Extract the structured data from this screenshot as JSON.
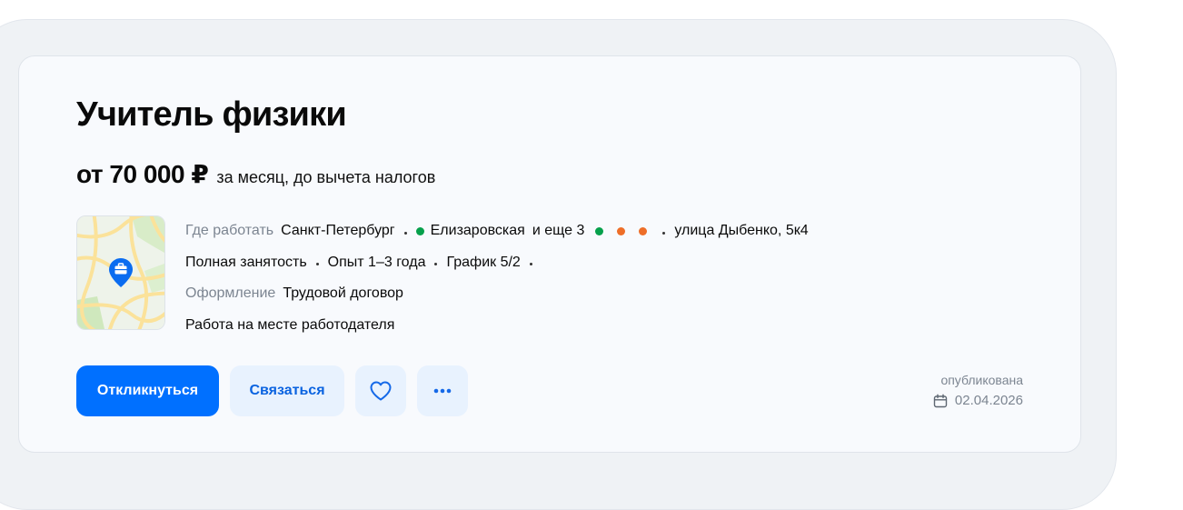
{
  "vacancy": {
    "title": "Учитель физики",
    "salary": "от 70 000 ₽",
    "salary_note": "за месяц, до вычета налогов"
  },
  "details": {
    "location_label": "Где работать",
    "city": "Санкт-Петербург",
    "metro_station": "Елизаровская",
    "metro_color": "#06a04b",
    "more_stations": "и еще 3",
    "more_station_colors": [
      "#06a04b",
      "#ee6e28",
      "#ee6e28"
    ],
    "address": "улица Дыбенко, 5к4",
    "employment": "Полная занятость",
    "experience": "Опыт 1–3 года",
    "schedule": "График 5/2",
    "contract_label": "Оформление",
    "contract": "Трудовой договор",
    "work_place": "Работа на месте работодателя"
  },
  "actions": {
    "respond": "Откликнуться",
    "contact": "Связаться",
    "favorite_icon": "heart-icon",
    "more_icon": "more-dots-icon"
  },
  "published": {
    "label": "опубликована",
    "date": "02.04.2026",
    "icon": "calendar-icon"
  },
  "colors": {
    "primary": "#0070ff",
    "secondary_bg": "#e8f2fe",
    "pin": "#0a6cf0"
  }
}
